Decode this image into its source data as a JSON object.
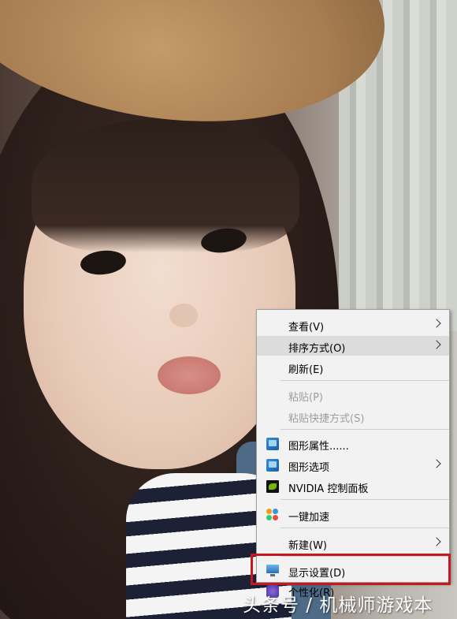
{
  "menu": {
    "view": "查看(V)",
    "sort_by": "排序方式(O)",
    "refresh": "刷新(E)",
    "paste": "粘贴(P)",
    "paste_shortcut": "粘贴快捷方式(S)",
    "graphics_properties": "图形属性......",
    "graphics_options": "图形选项",
    "nvidia_control_panel": "NVIDIA 控制面板",
    "one_key_speedup": "一键加速",
    "new": "新建(W)",
    "display_settings": "显示设置(D)",
    "personalize": "个性化(R)"
  },
  "icons": {
    "graphics_properties": "intel-graphics-icon",
    "graphics_options": "intel-graphics-icon",
    "nvidia": "nvidia-icon",
    "speedup": "speedup-icon",
    "display": "display-icon",
    "personalize": "personalize-icon"
  },
  "highlight_color": "#c4191e",
  "watermark": "头条号 / 机械师游戏本"
}
